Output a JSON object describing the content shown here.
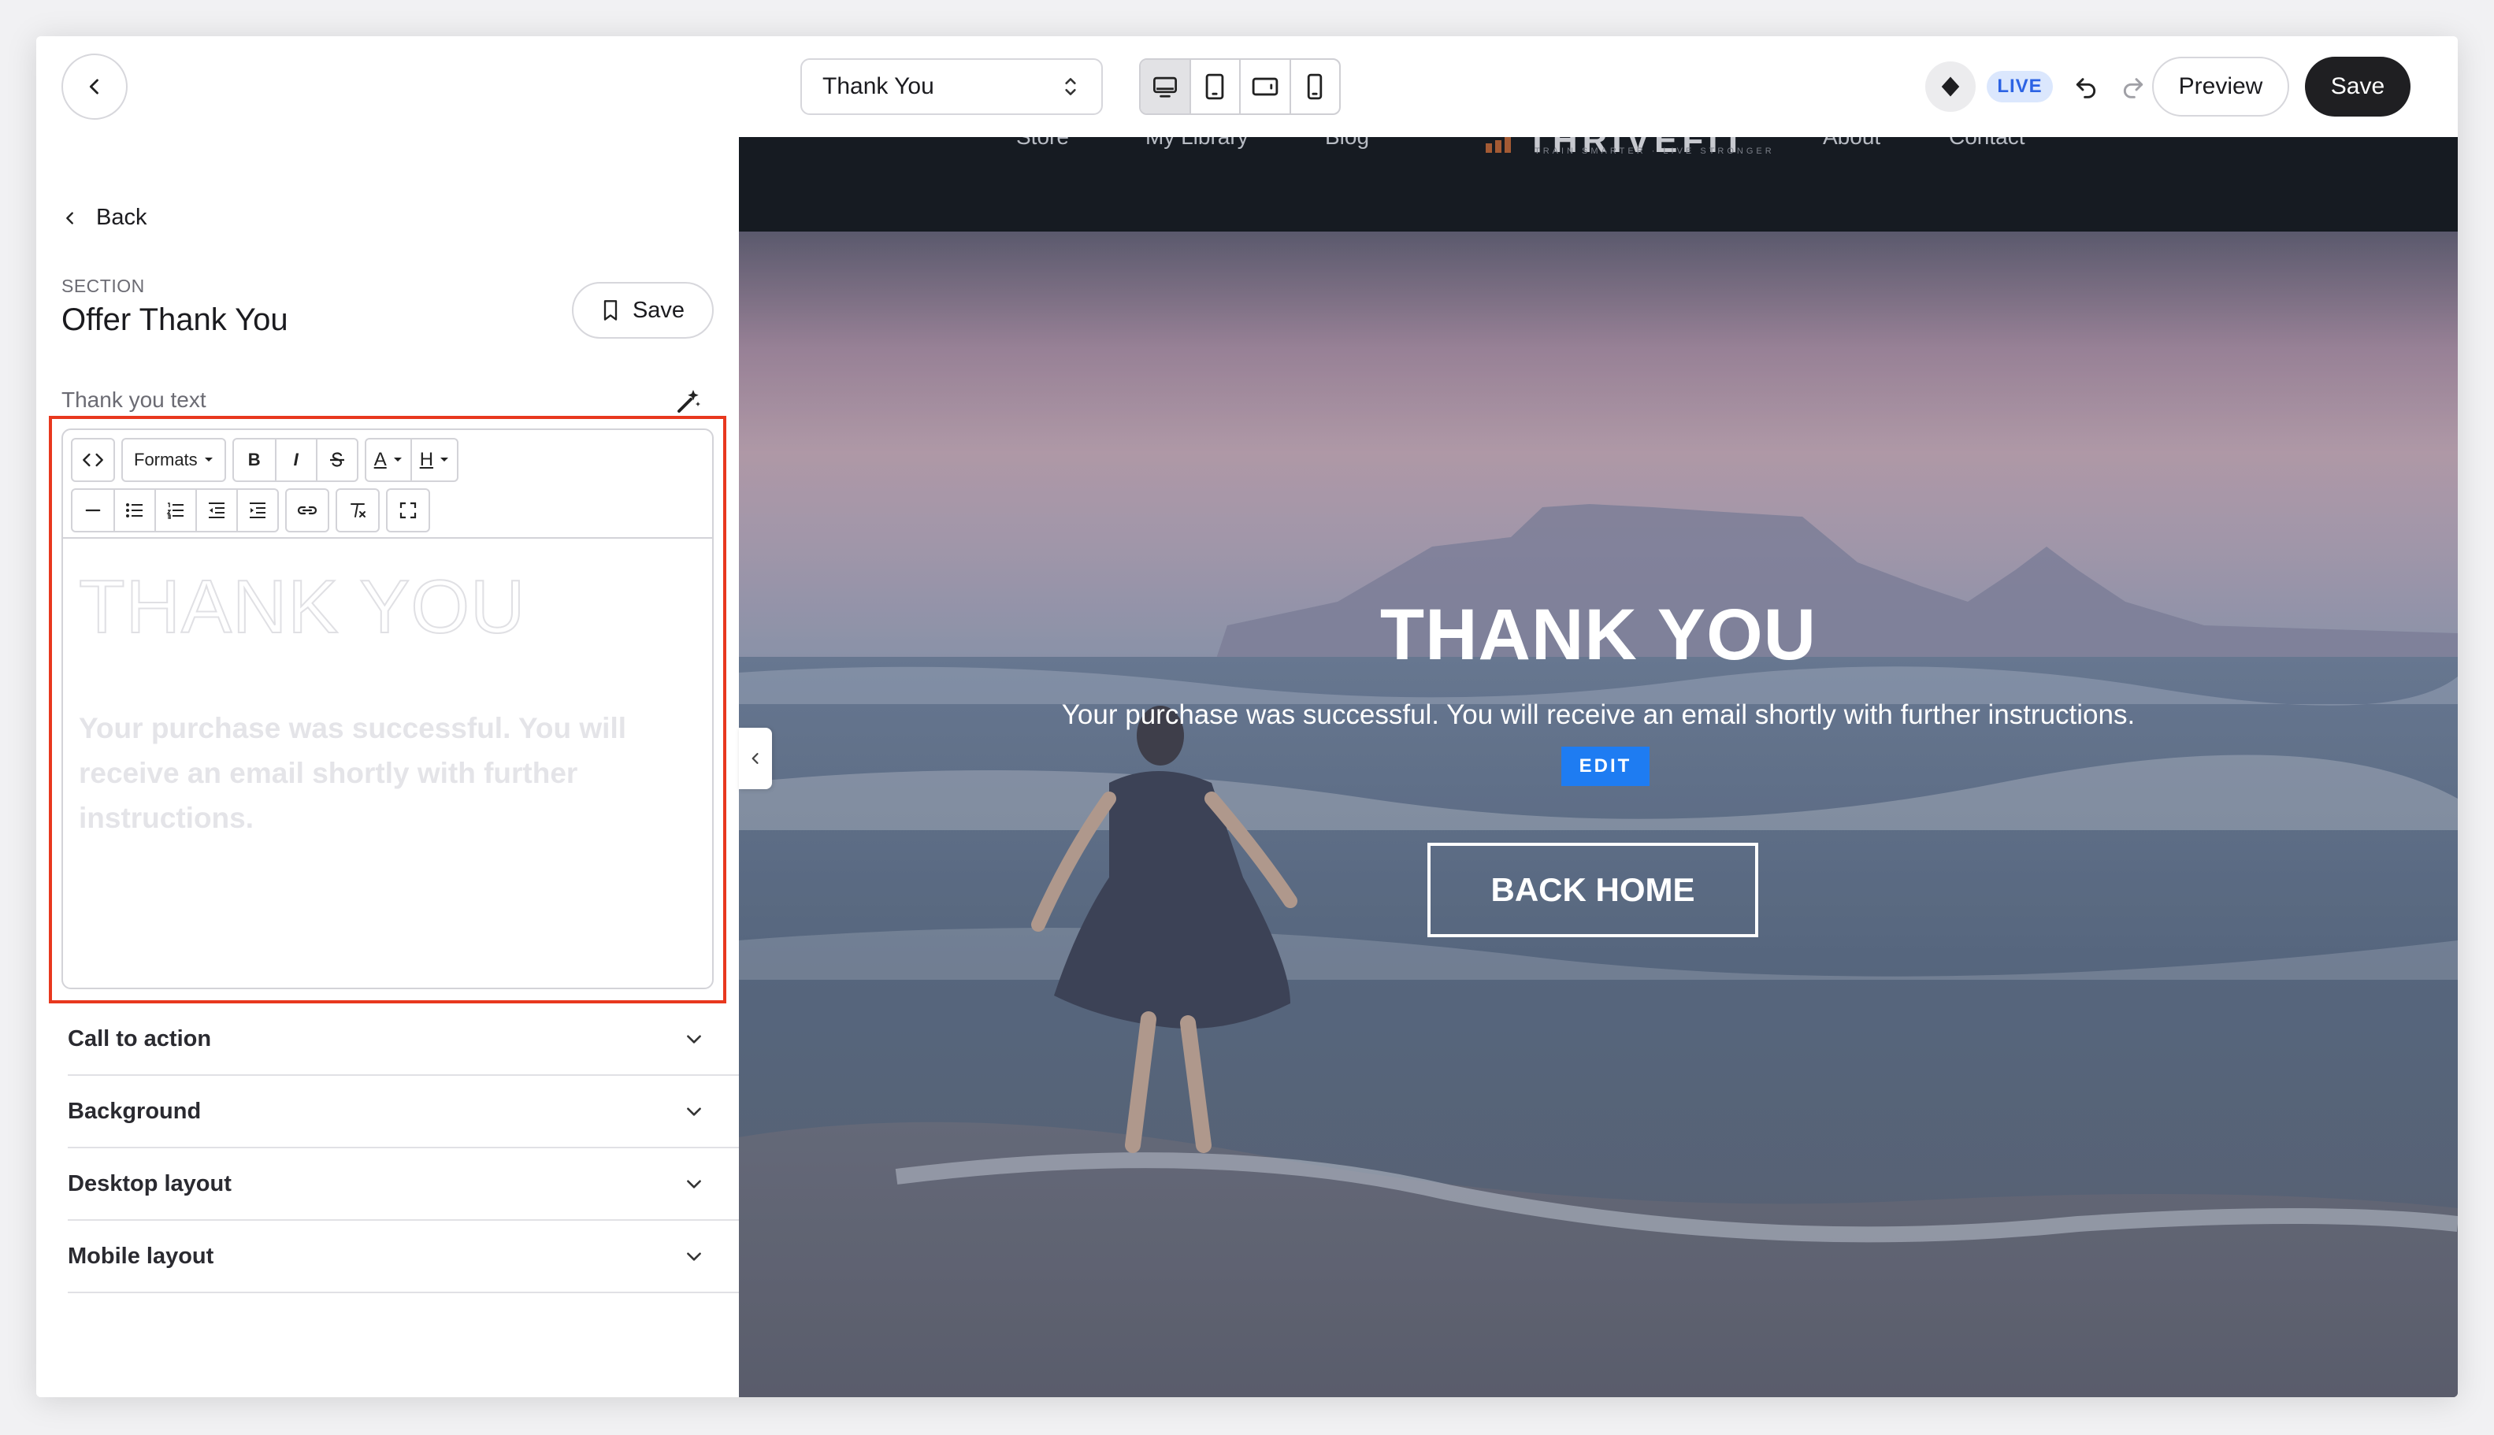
{
  "topbar": {
    "page_selector": "Thank You",
    "live_badge": "LIVE",
    "preview_label": "Preview",
    "save_label": "Save"
  },
  "sidebar": {
    "back_label": "Back",
    "section_label": "SECTION",
    "section_title": "Offer Thank You",
    "save_section_label": "Save",
    "field_label": "Thank you text",
    "toolbar": {
      "formats_label": "Formats",
      "bold": "B",
      "italic": "I",
      "font_color": "A",
      "highlight": "H"
    },
    "editor": {
      "title": "THANK YOU",
      "body": "Your purchase was successful. You will receive an email shortly with further instructions."
    },
    "accordions": [
      "Call to action",
      "Background",
      "Desktop layout",
      "Mobile layout"
    ]
  },
  "preview": {
    "nav_items": [
      "Store",
      "My Library",
      "Blog",
      "About",
      "Contact"
    ],
    "logo_text": "THRIVEFIT",
    "logo_tagline": "TRAIN SMARTER · LIVE STRONGER",
    "hero_title": "THANK YOU",
    "hero_subtitle": "Your purchase was successful. You will receive an email shortly with further instructions.",
    "edit_badge": "EDIT",
    "cta_label": "BACK HOME"
  },
  "colors": {
    "highlight_border": "#e8381e",
    "live_badge_bg": "#dbe7fd",
    "live_badge_text": "#2c63e4",
    "edit_badge": "#1e7cf2",
    "save_button": "#1f1f22",
    "site_nav_bg": "#161b22"
  }
}
